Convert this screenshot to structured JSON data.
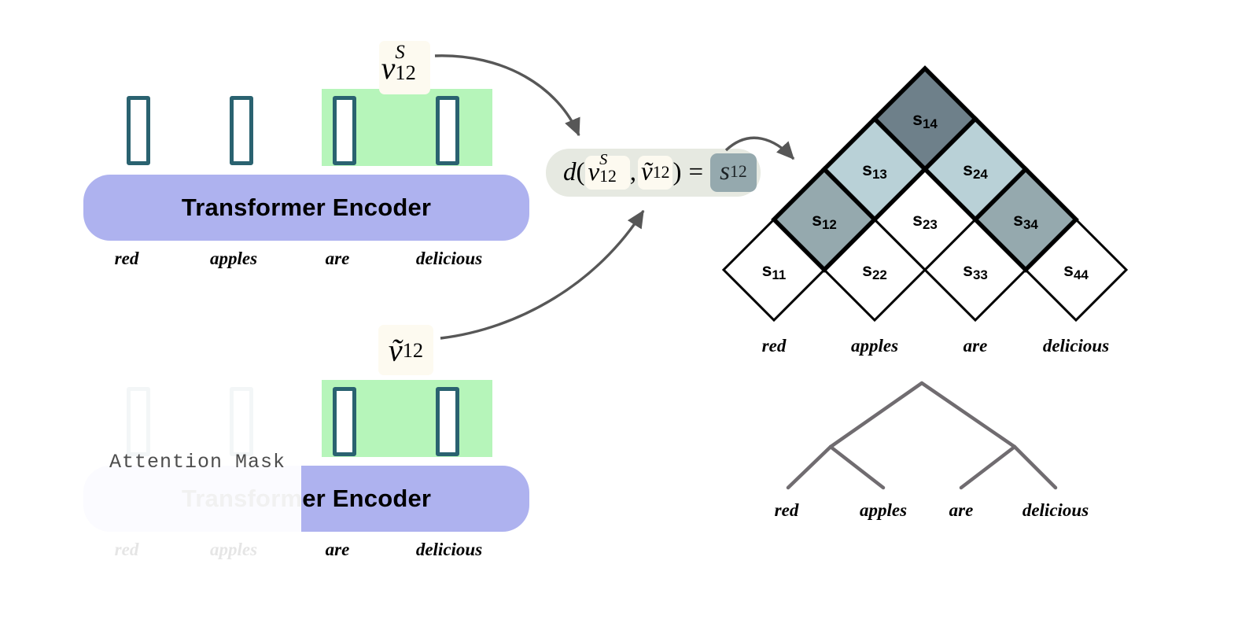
{
  "sentence": {
    "words": [
      "red",
      "apples",
      "are",
      "delicious"
    ]
  },
  "top_module": {
    "encoder_label": "Transformer Encoder",
    "vector_label": {
      "base": "v",
      "superscript": "S",
      "subscript": "12"
    },
    "highlighted_words": [
      "are",
      "delicious"
    ]
  },
  "bottom_module": {
    "encoder_label": "Transformer Encoder",
    "mask_caption": "Attention Mask",
    "vector_label": {
      "base": "ṽ",
      "subscript": "12"
    },
    "visible_words": [
      "are",
      "delicious"
    ],
    "masked_words": [
      "red",
      "apples"
    ]
  },
  "formula": {
    "d": "d",
    "open_paren": "(",
    "arg1": {
      "base": "v",
      "superscript": "S",
      "subscript": "12"
    },
    "comma": ",",
    "arg2": {
      "base": "ṽ",
      "subscript": "12"
    },
    "close_paren": ")",
    "equals": "=",
    "result": {
      "base": "s",
      "subscript": "12"
    }
  },
  "colors": {
    "token_border": "#2a6270",
    "span_highlight": "#b6f5ba",
    "encoder_bar": "#aeb2ef",
    "capsule_bg": "#e6e9e1",
    "chip_bg": "#fdfaf0",
    "cell_empty": "#ffffff",
    "cell_light": "#b9d1d7",
    "cell_mid": "#95a9ae",
    "cell_dark": "#6e808a",
    "tree_branch": "#706c70",
    "arrow": "#575757"
  },
  "chart_data": {
    "type": "heatmap",
    "title": "",
    "layout": "chart-table (inside-out triangular span matrix)",
    "xlabel": "",
    "ylabel": "",
    "categories": [
      "red",
      "apples",
      "are",
      "delicious"
    ],
    "tick_labels": [
      "red",
      "apples",
      "are",
      "delicious"
    ],
    "legend": [],
    "grid": true,
    "rows": [
      {
        "row": 1,
        "span_width": 1,
        "cells": [
          {
            "label": "s11",
            "i": 1,
            "j": 1,
            "value": 0,
            "shade": "empty",
            "color": "#ffffff"
          },
          {
            "label": "s22",
            "i": 2,
            "j": 2,
            "value": 0,
            "shade": "empty",
            "color": "#ffffff"
          },
          {
            "label": "s33",
            "i": 3,
            "j": 3,
            "value": 0,
            "shade": "empty",
            "color": "#ffffff"
          },
          {
            "label": "s44",
            "i": 4,
            "j": 4,
            "value": 0,
            "shade": "empty",
            "color": "#ffffff"
          }
        ]
      },
      {
        "row": 2,
        "span_width": 2,
        "cells": [
          {
            "label": "s12",
            "i": 1,
            "j": 2,
            "value": 2,
            "shade": "mid",
            "color": "#95a9ae"
          },
          {
            "label": "s23",
            "i": 2,
            "j": 3,
            "value": 0,
            "shade": "empty",
            "color": "#ffffff"
          },
          {
            "label": "s34",
            "i": 3,
            "j": 4,
            "value": 2,
            "shade": "mid",
            "color": "#95a9ae"
          }
        ]
      },
      {
        "row": 3,
        "span_width": 3,
        "cells": [
          {
            "label": "s13",
            "i": 1,
            "j": 3,
            "value": 1,
            "shade": "light",
            "color": "#b9d1d7"
          },
          {
            "label": "s24",
            "i": 2,
            "j": 4,
            "value": 1,
            "shade": "light",
            "color": "#b9d1d7"
          }
        ]
      },
      {
        "row": 4,
        "span_width": 4,
        "cells": [
          {
            "label": "s14",
            "i": 1,
            "j": 4,
            "value": 3,
            "shade": "dark",
            "color": "#6e808a"
          }
        ]
      }
    ],
    "shade_scale": {
      "empty": "#ffffff",
      "light": "#b9d1d7",
      "mid": "#95a9ae",
      "dark": "#6e808a"
    }
  },
  "parse_tree": {
    "leaves": [
      "red",
      "apples",
      "are",
      "delicious"
    ],
    "structure": "((red apples) (are delicious))"
  }
}
